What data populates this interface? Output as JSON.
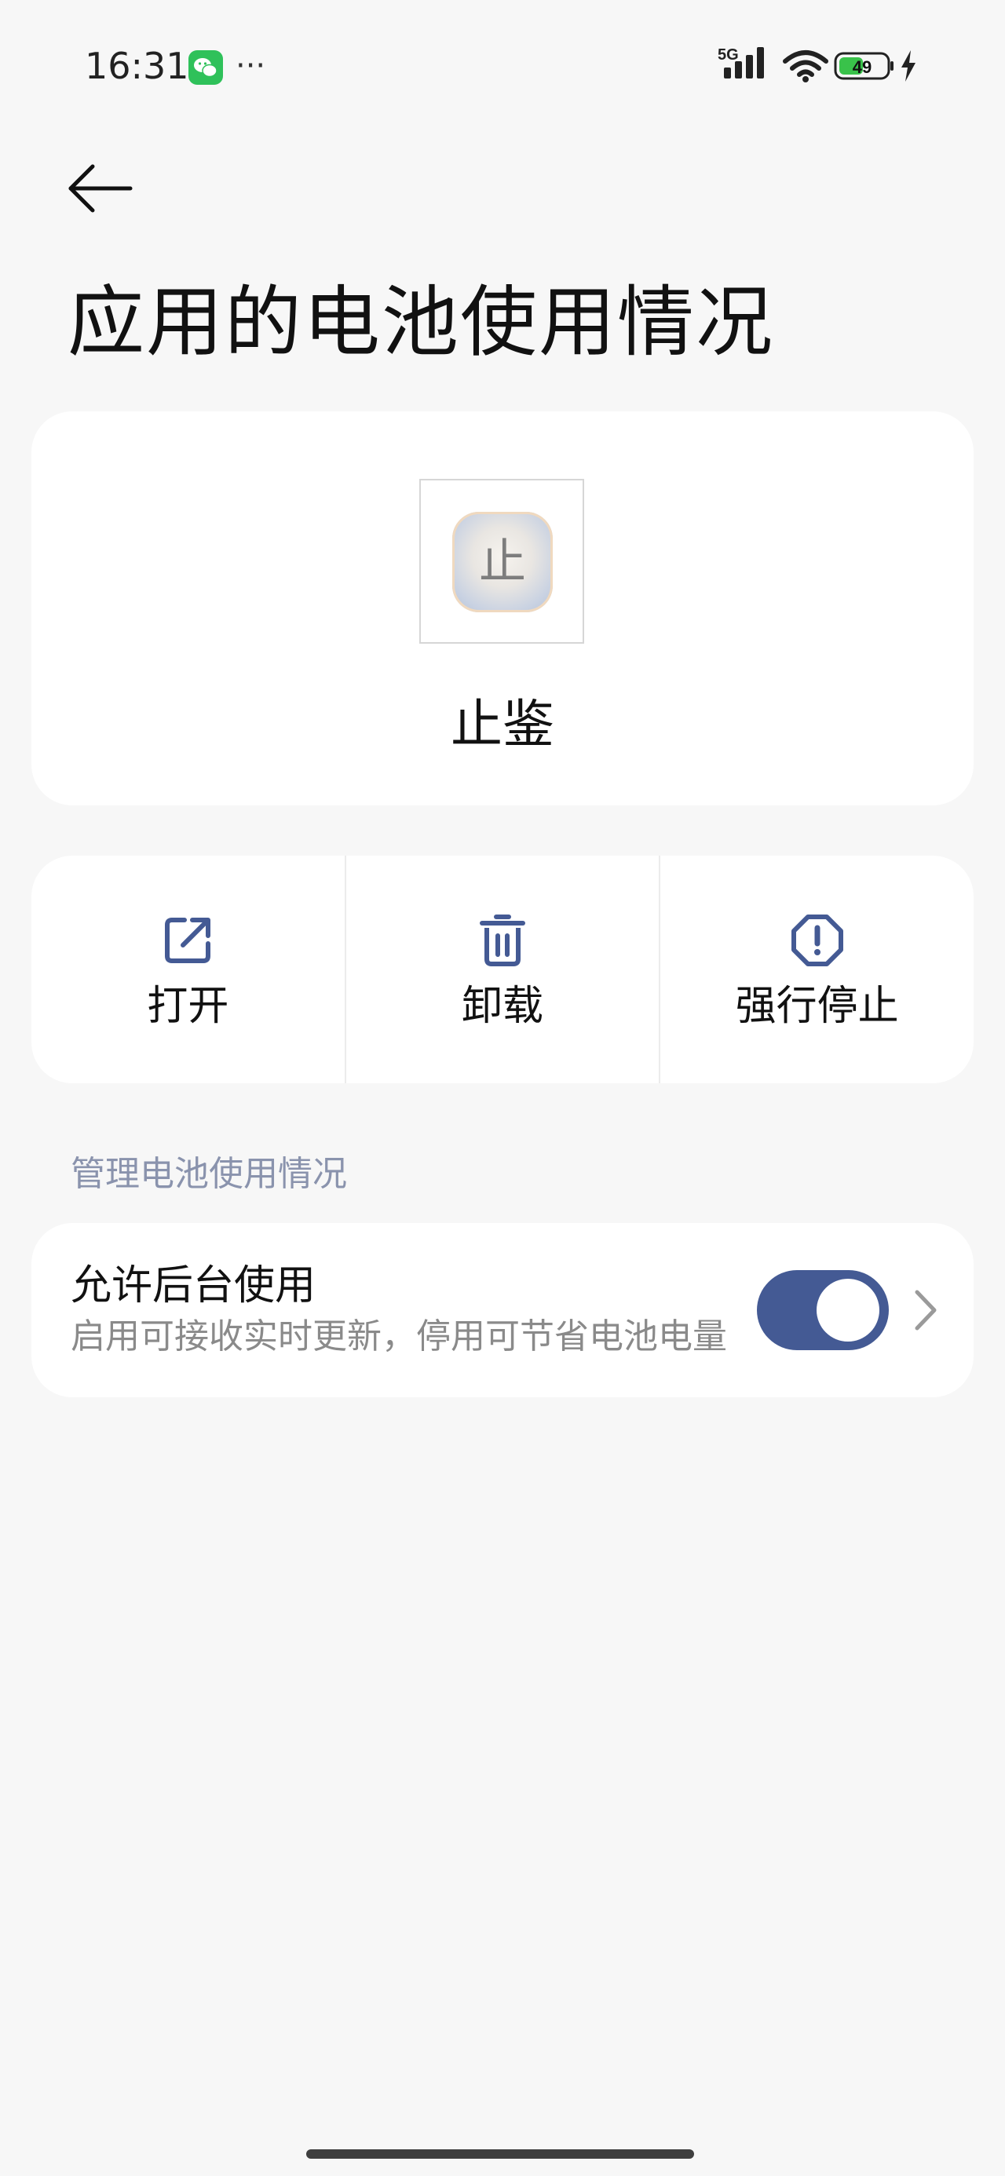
{
  "status_bar": {
    "time": "16:31",
    "more": "···",
    "network": "5G",
    "battery_level": "49",
    "icons": [
      "wechat-icon",
      "signal-icon",
      "wifi-icon",
      "battery-icon",
      "charging-icon"
    ]
  },
  "header": {
    "back_icon": "arrow-left-icon",
    "title": "应用的电池使用情况"
  },
  "app": {
    "name": "止鉴",
    "icon_glyph": "止"
  },
  "actions": [
    {
      "label": "打开",
      "icon": "open-external-icon"
    },
    {
      "label": "卸载",
      "icon": "trash-icon"
    },
    {
      "label": "强行停止",
      "icon": "alert-octagon-icon"
    }
  ],
  "battery_section": {
    "header": "管理电池使用情况",
    "background_usage": {
      "title": "允许后台使用",
      "description": "启用可接收实时更新，停用可节省电池电量",
      "enabled": true
    }
  },
  "colors": {
    "background": "#f7f7f7",
    "card": "#ffffff",
    "accent": "#445a94",
    "section_header": "#8a93ad",
    "secondary_text": "#8a8a8a"
  }
}
